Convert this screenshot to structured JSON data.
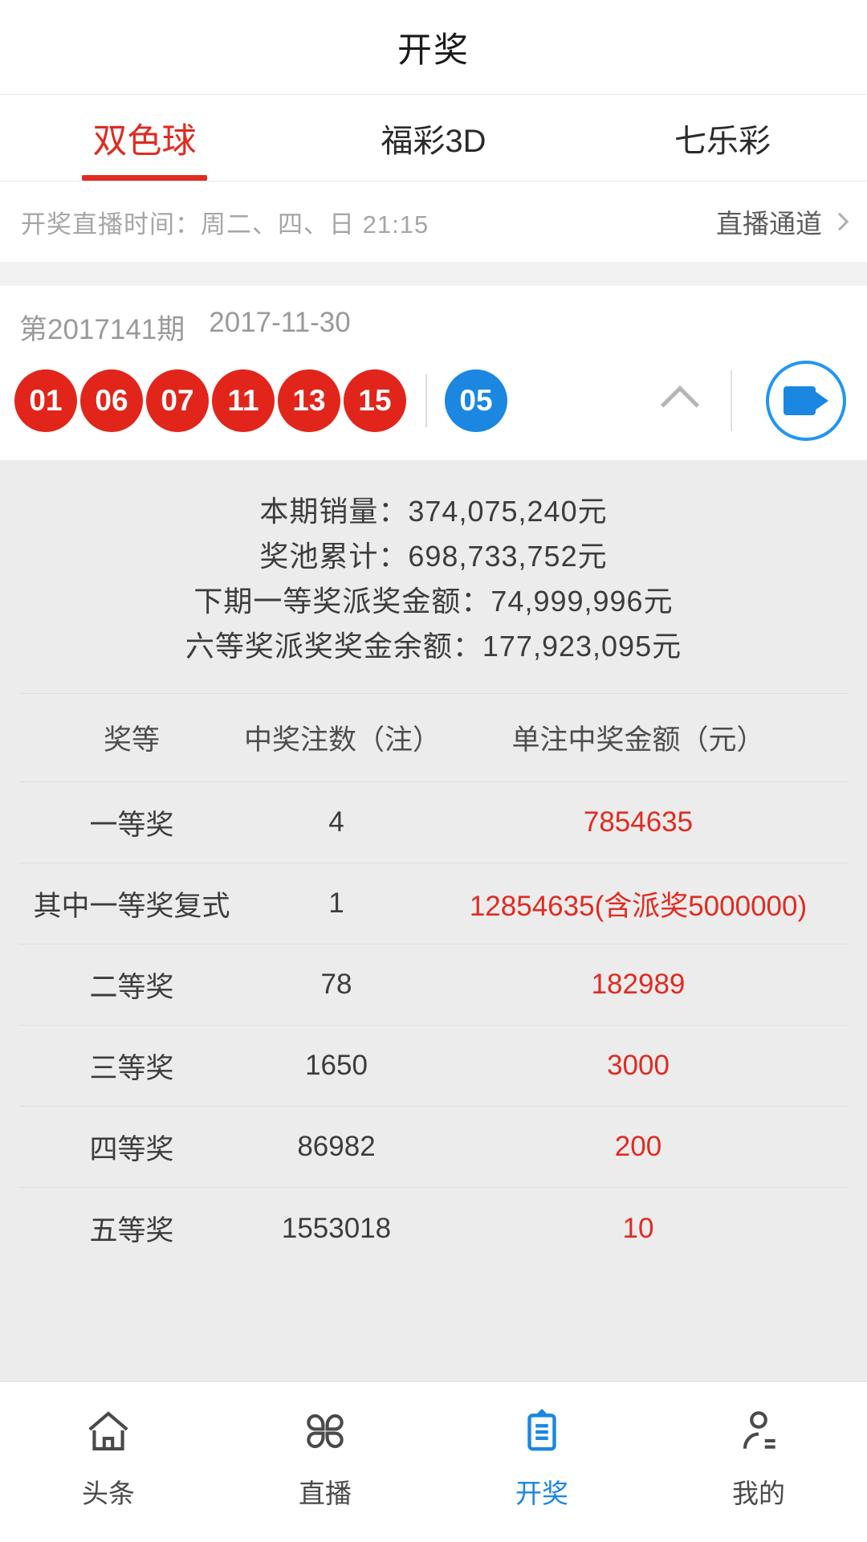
{
  "header": {
    "title": "开奖"
  },
  "tabs": [
    {
      "label": "双色球",
      "active": true
    },
    {
      "label": "福彩3D",
      "active": false
    },
    {
      "label": "七乐彩",
      "active": false
    }
  ],
  "live_bar": {
    "schedule_text": "开奖直播时间：周二、四、日 21:15",
    "channel_label": "直播通道",
    "chevron_icon": "chevron-right-icon"
  },
  "draw": {
    "issue": "第2017141期",
    "date": "2017-11-30",
    "red_balls": [
      "01",
      "06",
      "07",
      "11",
      "13",
      "15"
    ],
    "blue_balls": [
      "05"
    ],
    "collapse_icon": "chevron-up-icon",
    "video_icon": "video-camera-icon"
  },
  "info_lines": [
    "本期销量：374,075,240元",
    "奖池累计：698,733,752元",
    "下期一等奖派奖金额：74,999,996元",
    "六等奖派奖奖金余额：177,923,095元"
  ],
  "prize_table": {
    "headers": [
      "奖等",
      "中奖注数（注）",
      "单注中奖金额（元）"
    ],
    "rows": [
      {
        "level": "一等奖",
        "count": "4",
        "amount": "7854635"
      },
      {
        "level": "其中一等奖复式",
        "count": "1",
        "amount": "12854635(含派奖5000000)"
      },
      {
        "level": "二等奖",
        "count": "78",
        "amount": "182989"
      },
      {
        "level": "三等奖",
        "count": "1650",
        "amount": "3000"
      },
      {
        "level": "四等奖",
        "count": "86982",
        "amount": "200"
      },
      {
        "level": "五等奖",
        "count": "1553018",
        "amount": "10"
      }
    ]
  },
  "bottom_nav": [
    {
      "label": "头条",
      "icon": "home-icon",
      "active": false
    },
    {
      "label": "直播",
      "icon": "grid-clover-icon",
      "active": false
    },
    {
      "label": "开奖",
      "icon": "clipboard-icon",
      "active": true
    },
    {
      "label": "我的",
      "icon": "person-icon",
      "active": false
    }
  ],
  "colors": {
    "accent_red": "#e02b21",
    "ball_red": "#e1251b",
    "ball_blue": "#1b87e1",
    "accent_blue": "#1b87e1",
    "panel_bg": "#ececec"
  }
}
